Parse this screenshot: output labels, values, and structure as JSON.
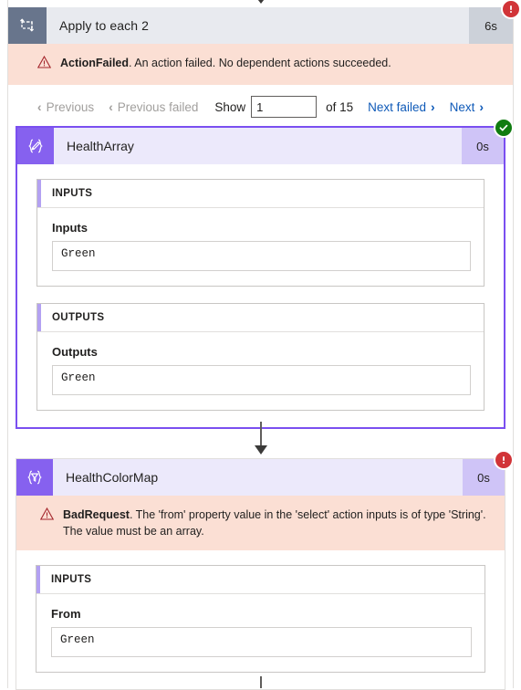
{
  "colors": {
    "scope_icon_bg": "#68758c",
    "scope_header_bg": "#e8eaef",
    "scope_duration_bg": "#ccd1d9",
    "action_icon_bg": "#8661ef",
    "action_header_bg": "#ece9fb",
    "action_duration_bg": "#cfc4f7",
    "selection_border": "#7a4ff0",
    "error_banner_bg": "#fbdfd4",
    "error_badge": "#d13438",
    "success_badge": "#107c10",
    "link": "#0f5ab8",
    "disabled_link": "#a19f9d",
    "io_accent": "#b3a1f2"
  },
  "scope": {
    "icon": "apply-to-each-loop-icon",
    "title": "Apply to each 2",
    "duration": "6s",
    "status": "failed",
    "status_badge_icon": "error-exclamation-icon",
    "error": {
      "icon": "warning-triangle-icon",
      "code": "ActionFailed",
      "message": ". An action failed. No dependent actions succeeded."
    }
  },
  "pager": {
    "previous_label": "Previous",
    "previous_enabled": false,
    "previous_failed_label": "Previous failed",
    "previous_failed_enabled": false,
    "show_label": "Show",
    "page_value": "1",
    "page_placeholder": "",
    "of_label": "of 15",
    "total_pages": 15,
    "next_failed_label": "Next failed",
    "next_failed_enabled": true,
    "next_label": "Next",
    "next_enabled": true,
    "chevron_left": "‹",
    "chevron_right": "›"
  },
  "actions": [
    {
      "name": "HealthArray",
      "icon": "compose-braces-pencil-icon",
      "duration": "0s",
      "status": "succeeded",
      "status_badge_icon": "success-check-icon",
      "selected": true,
      "sections": [
        {
          "heading": "INPUTS",
          "fields": [
            {
              "label": "Inputs",
              "value": "Green"
            }
          ]
        },
        {
          "heading": "OUTPUTS",
          "fields": [
            {
              "label": "Outputs",
              "value": "Green"
            }
          ]
        }
      ]
    },
    {
      "name": "HealthColorMap",
      "icon": "select-braces-funnel-icon",
      "duration": "0s",
      "status": "failed",
      "status_badge_icon": "error-exclamation-icon",
      "selected": false,
      "error": {
        "icon": "warning-triangle-icon",
        "code": "BadRequest",
        "message": ". The 'from' property value in the 'select' action inputs is of type 'String'. The value must be an array."
      },
      "sections": [
        {
          "heading": "INPUTS",
          "fields": [
            {
              "label": "From",
              "value": "Green"
            }
          ]
        }
      ]
    }
  ]
}
